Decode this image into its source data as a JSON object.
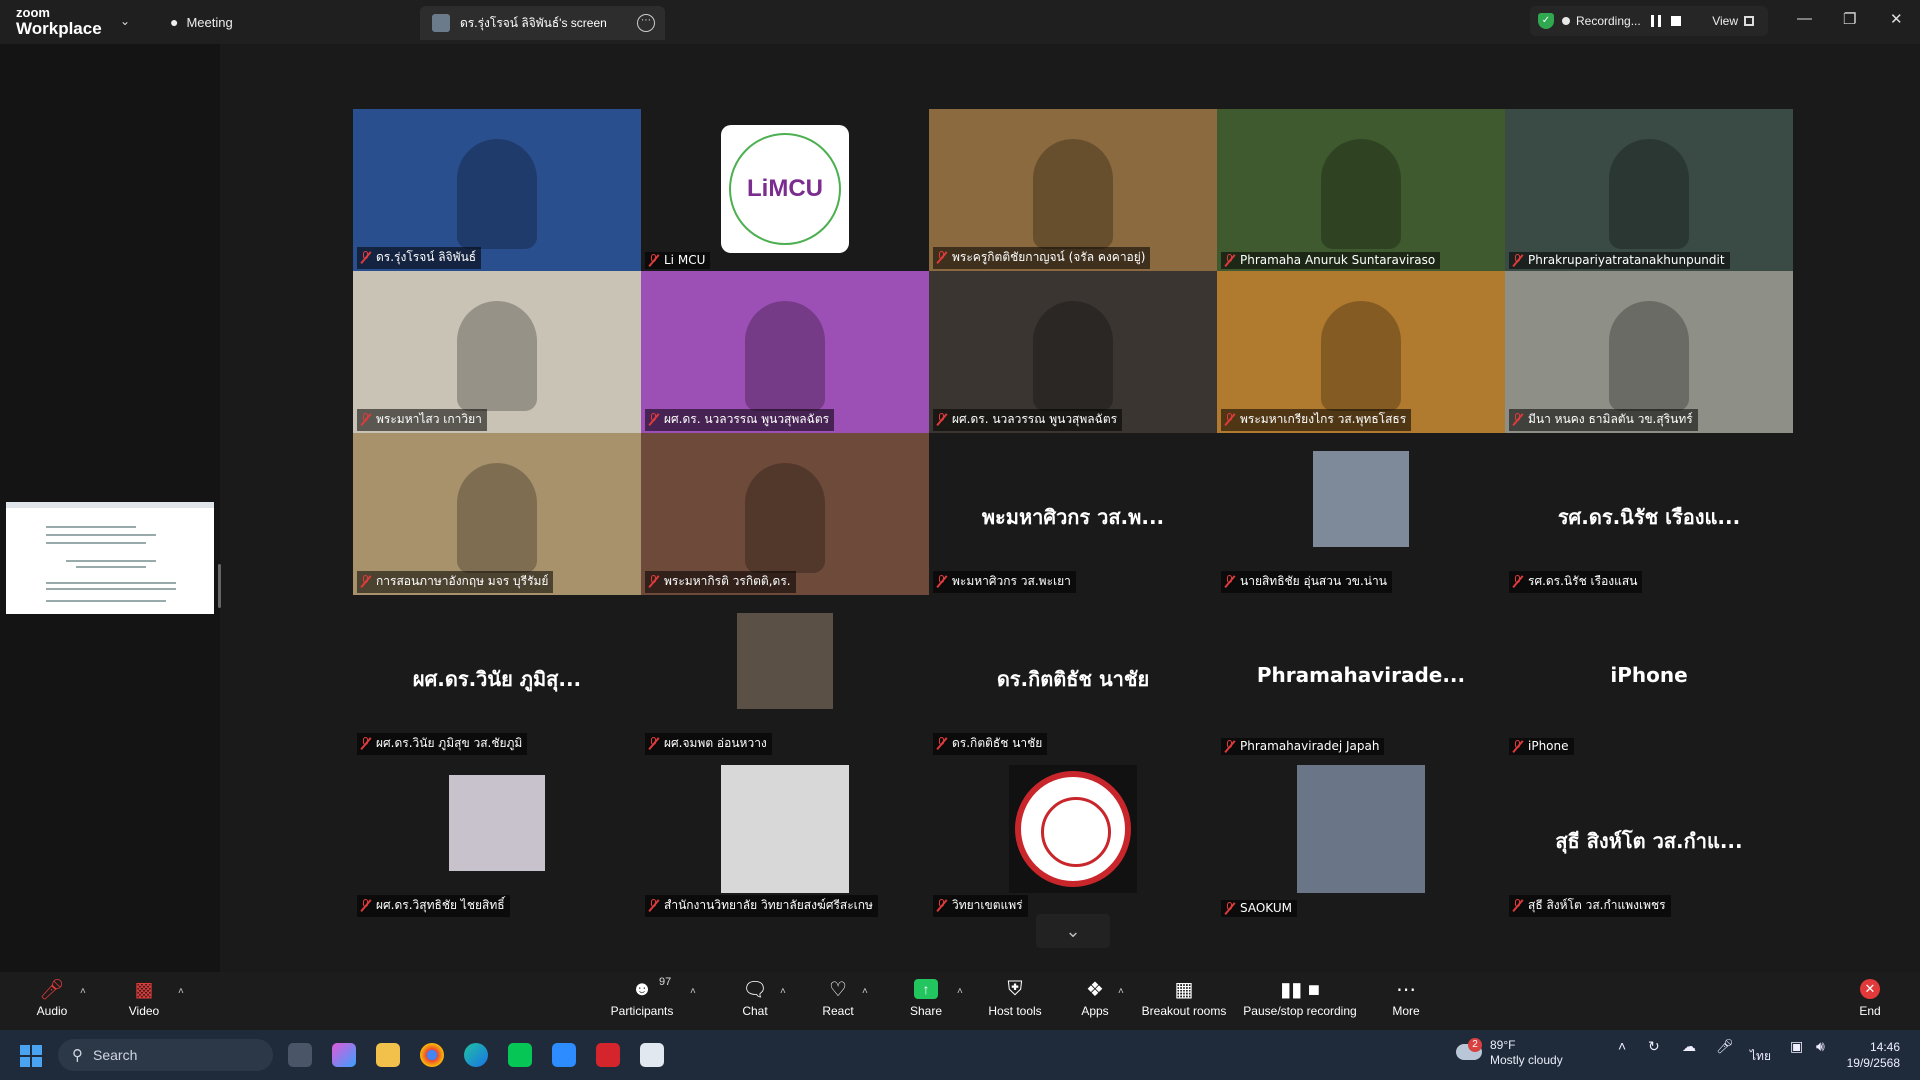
{
  "titlebar": {
    "logo_top": "zoom",
    "logo_bottom": "Workplace",
    "meeting_label": "Meeting",
    "screen_tab_label": "ดร.รุ่งโรจน์ ลิจิพันธ์'s screen",
    "recording_label": "Recording...",
    "view_label": "View"
  },
  "gallery": {
    "tiles": [
      {
        "name": "ดร.รุ่งโรจน์ ลิจิพันธ์",
        "type": "video",
        "color": "#2a4f8f"
      },
      {
        "name": "Li MCU",
        "type": "logo",
        "logo_text": "LiMCU"
      },
      {
        "name": "พระครูกิตติชัยกาญจน์ (จรัล คงคาอยู่)",
        "type": "video",
        "color": "#8a6a3e"
      },
      {
        "name": "Phramaha Anuruk Suntaraviraso",
        "type": "video",
        "color": "#3f5a2f"
      },
      {
        "name": "Phrakrupariyatratanakhunpundit",
        "type": "video",
        "color": "#3a4a44",
        "active": true
      },
      {
        "name": "พระมหาไสว เกาวิยา",
        "type": "video",
        "color": "#c9c3b5"
      },
      {
        "name": "ผศ.ดร. นวลวรรณ พูนวสุพลฉัตร",
        "type": "video",
        "color": "#9c4fb5"
      },
      {
        "name": "ผศ.ดร. นวลวรรณ พูนวสุพลฉัตร",
        "type": "video",
        "color": "#3a3530"
      },
      {
        "name": "พระมหาเกรียงไกร วส.พุทธโสธร",
        "type": "video",
        "color": "#b07a2f"
      },
      {
        "name": "มีนา หนคง ธามิลตัน วข.สุรินทร์",
        "type": "video",
        "color": "#8e8f86"
      },
      {
        "name": "การสอนภาษาอังกฤษ มจร บุรีรัมย์",
        "type": "video",
        "color": "#a8926c"
      },
      {
        "name": "พระมหากิรติ วรกิตติ,ดร.",
        "type": "video",
        "color": "#6e4a3a"
      },
      {
        "name": "พะมหาศิวกร วส.พะเยา",
        "type": "name",
        "display": "พะมหาศิวกร วส.พ..."
      },
      {
        "name": "นายสิทธิชัย อุ่นสวน วข.น่าน",
        "type": "photo",
        "color": "#7e8a99"
      },
      {
        "name": "รศ.ดร.นิรัช เรืองแสน",
        "type": "name",
        "display": "รศ.ดร.นิรัช เรืองแ..."
      },
      {
        "name": "ผศ.ดร.วินัย ภูมิสุข วส.ชัยภูมิ",
        "type": "name",
        "display": "ผศ.ดร.วินัย ภูมิสุ..."
      },
      {
        "name": "ผศ.จมพต อ่อนหวาง",
        "type": "photo",
        "color": "#5a5046"
      },
      {
        "name": "ดร.กิตติธัช นาชัย",
        "type": "name",
        "display": "ดร.กิตติธัช นาชัย"
      },
      {
        "name": "Phramahaviradej Japah",
        "type": "name",
        "display": "Phramahavirade..."
      },
      {
        "name": "iPhone",
        "type": "name",
        "display": "iPhone"
      },
      {
        "name": "ผศ.ดร.วิสุทธิชัย ไชยสิทธิ์",
        "type": "photo",
        "color": "#c7c2cb"
      },
      {
        "name": "สำนักงานวิทยาลัย วิทยาลัยสงฆ์ศรีสะเกษ",
        "type": "photo",
        "color": "#d8d8d8"
      },
      {
        "name": "วิทยาเขตแพร่",
        "type": "seal",
        "color": "#c8262b"
      },
      {
        "name": "SAOKUM",
        "type": "photo",
        "color": "#6a7588"
      },
      {
        "name": "สุธี สิงห์โต วส.กำแพงเพชร",
        "type": "name",
        "display": "สุธี สิงห์โต วส.กำแ..."
      }
    ]
  },
  "toolbar": {
    "audio": "Audio",
    "video": "Video",
    "participants": "Participants",
    "participants_count": "97",
    "chat": "Chat",
    "react": "React",
    "share": "Share",
    "host_tools": "Host tools",
    "apps": "Apps",
    "breakout": "Breakout rooms",
    "pause_recording": "Pause/stop recording",
    "more": "More",
    "end": "End"
  },
  "taskbar": {
    "search_placeholder": "Search",
    "weather_temp": "89°F",
    "weather_desc": "Mostly cloudy",
    "weather_badge": "2",
    "lang": "ไทย",
    "time": "14:46",
    "date": "19/9/2568"
  },
  "colors": {
    "active_border": "#2fd17e",
    "muted_red": "#e03a3a",
    "share_green": "#22c55e",
    "end_red": "#e23a3a"
  }
}
